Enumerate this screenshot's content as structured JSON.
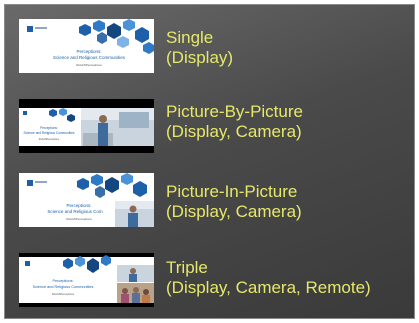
{
  "layouts": [
    {
      "id": "single",
      "title": "Single",
      "subtitle": "(Display)",
      "thumbnail": {
        "slide_title": "Perceptions:",
        "slide_subtitle": "Science and Religious Communities",
        "hashtag": "#AAASPerceptions"
      }
    },
    {
      "id": "picture-by-picture",
      "title": "Picture-By-Picture",
      "subtitle": "(Display, Camera)",
      "thumbnail": {
        "slide_title": "Perceptions:",
        "slide_subtitle": "Science and Religious Communities",
        "hashtag": "#AAASPerceptions"
      }
    },
    {
      "id": "picture-in-picture",
      "title": "Picture-In-Picture",
      "subtitle": "(Display, Camera)",
      "thumbnail": {
        "slide_title": "Perceptions:",
        "slide_subtitle": "Science and Religious Com",
        "hashtag": "#AAASPerceptions"
      }
    },
    {
      "id": "triple",
      "title": "Triple",
      "subtitle": "(Display, Camera, Remote)",
      "thumbnail": {
        "slide_title": "Perceptions:",
        "slide_subtitle": "Science and Religious Communities",
        "hashtag": "#AAASPerceptions"
      }
    }
  ],
  "colors": {
    "label_text": "#e6e86a",
    "panel_background": "#4a4a4a",
    "slide_accent": "#1d5fa8"
  }
}
